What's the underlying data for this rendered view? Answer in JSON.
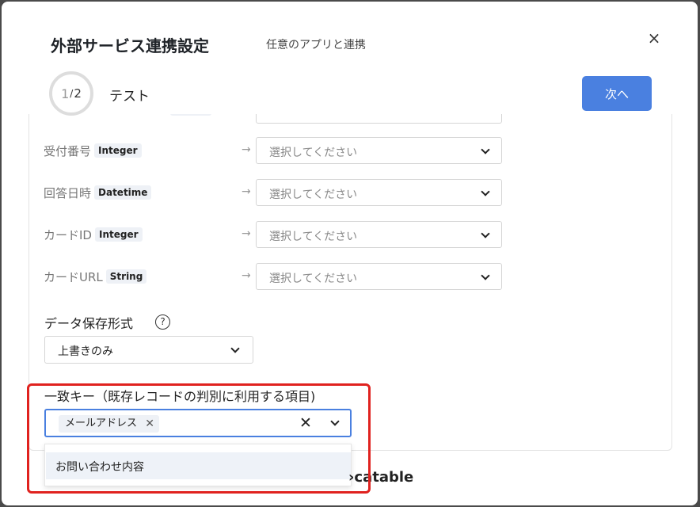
{
  "dialog": {
    "title": "外部サービス連携設定",
    "subtitle": "任意のアプリと連携",
    "close_icon": "×"
  },
  "stepper": {
    "current": "1",
    "separator": "/",
    "total": "2",
    "label": "テスト"
  },
  "next_button": "次へ",
  "mapping_rows": [
    {
      "label": "受付番号",
      "type": "Integer",
      "placeholder": "選択してください"
    },
    {
      "label": "回答日時",
      "type": "Datetime",
      "placeholder": "選択してください"
    },
    {
      "label": "カードID",
      "type": "Integer",
      "placeholder": "選択してください"
    },
    {
      "label": "カードURL",
      "type": "String",
      "placeholder": "選択してください"
    }
  ],
  "arrow_glyph": "→",
  "save_format": {
    "label": "データ保存形式",
    "help_icon": "?",
    "value": "上書きのみ"
  },
  "match_key": {
    "label": "一致キー（既存レコードの判別に利用する項目)",
    "selected_tag": "メールアドレス",
    "tag_remove_icon": "✕",
    "clear_icon": "✕",
    "options": [
      "お問い合わせ内容"
    ]
  },
  "brand": "catable",
  "brand_mark": "›",
  "colors": {
    "primary": "#4a80e0",
    "highlight": "#e0221f"
  }
}
